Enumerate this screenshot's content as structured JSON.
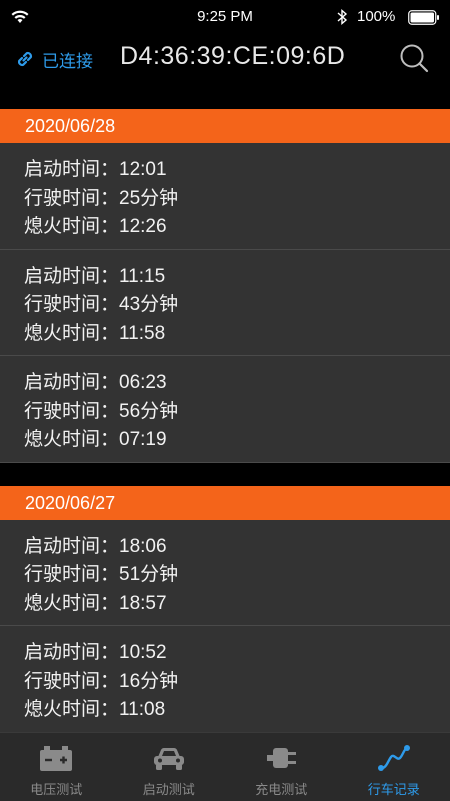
{
  "status_bar": {
    "time": "9:25 PM",
    "battery": "100%"
  },
  "header": {
    "connection_label": "已连接",
    "device_id": "D4:36:39:CE:09:6D"
  },
  "colors": {
    "accent": "#f4641a",
    "active_tab": "#2e9bea",
    "card_bg": "#333333"
  },
  "labels": {
    "start": "启动时间：",
    "drive": "行驶时间：",
    "stop": "熄火时间："
  },
  "days": [
    {
      "date": "2020/06/28",
      "trips": [
        {
          "start": "12:01",
          "drive": "25分钟",
          "stop": "12:26"
        },
        {
          "start": "11:15",
          "drive": "43分钟",
          "stop": "11:58"
        },
        {
          "start": "06:23",
          "drive": "56分钟",
          "stop": "07:19"
        }
      ]
    },
    {
      "date": "2020/06/27",
      "trips": [
        {
          "start": "18:06",
          "drive": "51分钟",
          "stop": "18:57"
        },
        {
          "start": "10:52",
          "drive": "16分钟",
          "stop": "11:08"
        }
      ]
    }
  ],
  "tabs": [
    {
      "label": "电压测试",
      "icon": "battery-icon",
      "active": false
    },
    {
      "label": "启动测试",
      "icon": "car-icon",
      "active": false
    },
    {
      "label": "充电测试",
      "icon": "plug-icon",
      "active": false
    },
    {
      "label": "行车记录",
      "icon": "wave-icon",
      "active": true
    }
  ]
}
